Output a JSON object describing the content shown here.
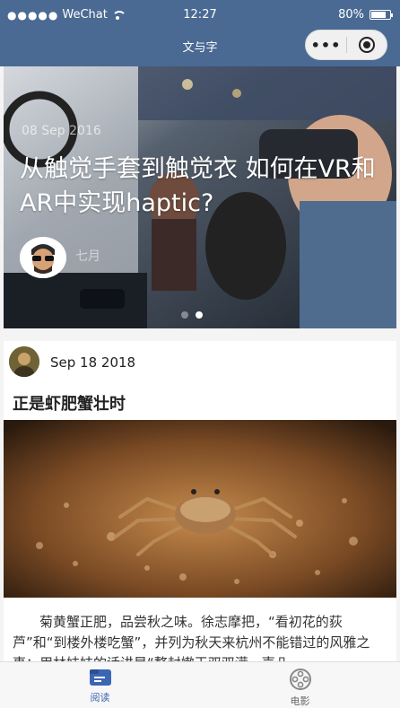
{
  "status_bar": {
    "carrier": "WeChat",
    "time": "12:27",
    "battery": "80%",
    "battery_level": 0.8
  },
  "nav": {
    "title": "文与字",
    "more_icon": "more-dots-icon",
    "close_icon": "target-circle-icon"
  },
  "swiper": {
    "date": "08 Sep 2016",
    "title": "从触觉手套到触觉衣 如何在VR和AR中实现haptic?",
    "author": "七月",
    "current_slide": 2,
    "total_slides": 2
  },
  "post": {
    "date": "Sep 18 2018",
    "title": "正是虾肥蟹壮时",
    "content": "菊黄蟹正肥，品尝秋之味。徐志摩把，“看初花的荻芦”和“到楼外楼吃蟹”，并列为秋天来杭州不能错过的风雅之事；用林妹妹的话讲是“螯封嫩玉双双满，壳凸"
  },
  "tabbar": {
    "items": [
      {
        "label": "阅读",
        "icon": "reading-icon",
        "active": true
      },
      {
        "label": "电影",
        "icon": "film-reel-icon",
        "active": false
      }
    ],
    "active_color": "#3b66b3"
  }
}
